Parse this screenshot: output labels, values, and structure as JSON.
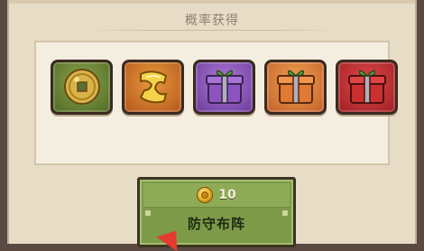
{
  "section_title": "概率获得",
  "rewards": [
    {
      "icon": "coin-icon",
      "color": "#6d8a35"
    },
    {
      "icon": "scroll-icon",
      "color": "#d07a2c"
    },
    {
      "icon": "purple-gift-box-icon",
      "color": "#8e55c0"
    },
    {
      "icon": "orange-gift-box-icon",
      "color": "#db7a36"
    },
    {
      "icon": "red-gift-box-icon",
      "color": "#c73235"
    }
  ],
  "action": {
    "cost_value": "10",
    "cost_icon": "gold-coin-icon",
    "label": "防守布阵"
  },
  "colors": {
    "panel": "#e7dcc6",
    "button_green": "#7d9a49",
    "pointer": "#e53a2f"
  }
}
